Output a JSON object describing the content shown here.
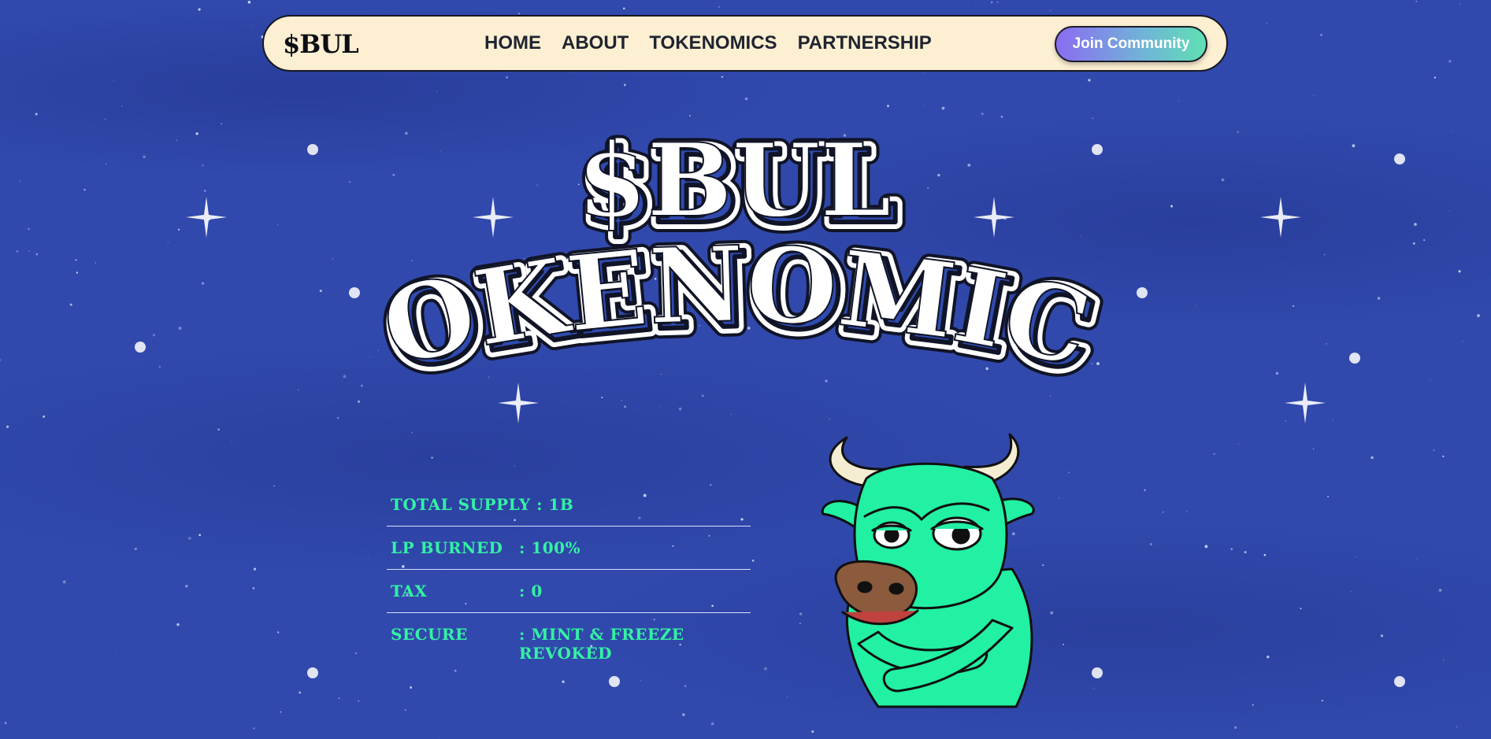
{
  "navbar": {
    "logo": "$BUL",
    "links": [
      {
        "label": "HOME"
      },
      {
        "label": "ABOUT"
      },
      {
        "label": "TOKENOMICS"
      },
      {
        "label": "PARTNERSHIP"
      }
    ],
    "join_label": "Join Community"
  },
  "hero": {
    "title_top": "$BUL",
    "title_bottom": "TOKENOMICS"
  },
  "tokenomics": {
    "total_supply": "TOTAL SUPPLY : 1B",
    "rows": [
      {
        "label": "LP BURNED",
        "value": ": 100%"
      },
      {
        "label": "TAX",
        "value": ": 0"
      },
      {
        "label": "SECURE",
        "value": ": MINT & FREEZE REVOKED"
      }
    ]
  },
  "colors": {
    "background": "#3149ad",
    "navbar": "#fcefd2",
    "accent_green": "#33f2a3",
    "mascot_green": "#22f0a3",
    "button_gradient_start": "#8b6cf2",
    "button_gradient_end": "#5fe0b2"
  },
  "mascot": {
    "icon": "green-bull-mascot"
  }
}
